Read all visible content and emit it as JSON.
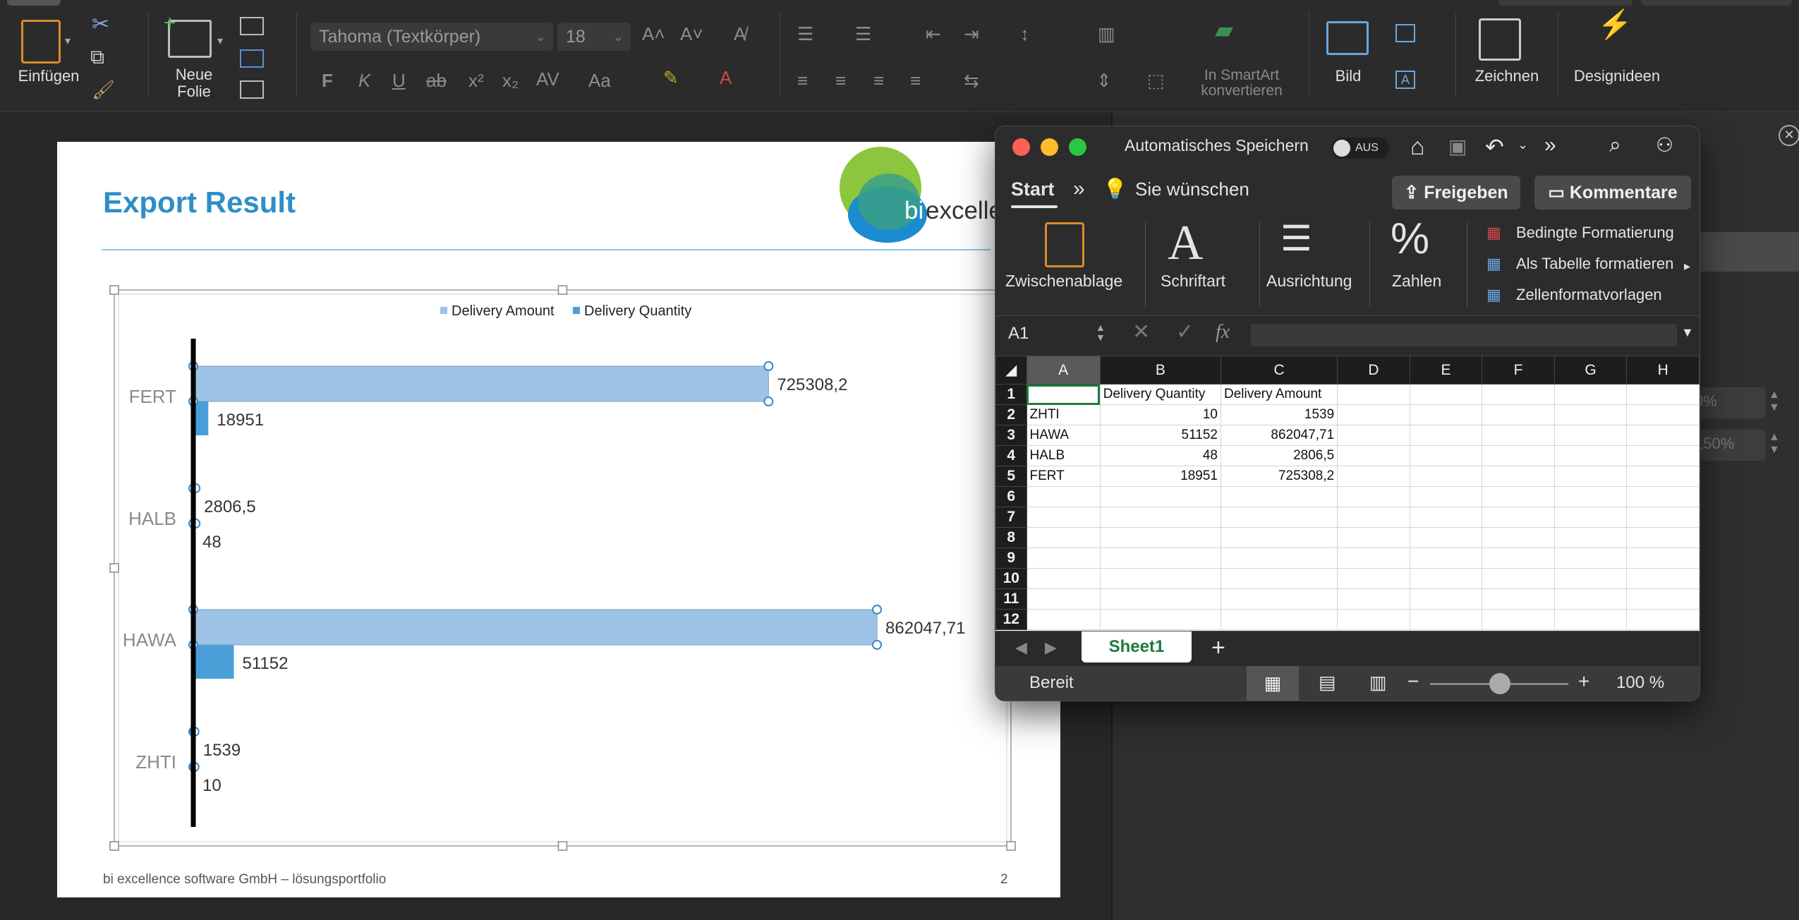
{
  "ppt_ribbon": {
    "paste_label": "Einfügen",
    "new_slide_label": "Neue Folie",
    "font_name": "Tahoma (Textkörper)",
    "font_size": "18",
    "smartart_label": "In SmartArt konvertieren",
    "picture_label": "Bild",
    "draw_label": "Zeichnen",
    "design_label": "Designideen"
  },
  "slide": {
    "title": "Export Result",
    "logo_text": "bi excelle",
    "footer": "bi excellence software GmbH – lösungsportfolio",
    "page_number": "2"
  },
  "chart_data": {
    "type": "bar",
    "orientation": "horizontal",
    "categories": [
      "FERT",
      "HALB",
      "HAWA",
      "ZHTI"
    ],
    "series": [
      {
        "name": "Delivery Amount",
        "values": [
          725308.2,
          2806.5,
          862047.71,
          1539
        ],
        "labels": [
          "725308,2",
          "2806,5",
          "862047,71",
          "1539"
        ],
        "color": "#9dc3e6"
      },
      {
        "name": "Delivery Quantity",
        "values": [
          18951,
          48,
          51152,
          10
        ],
        "labels": [
          "18951",
          "48",
          "51152",
          "10"
        ],
        "color": "#4a9fd8"
      }
    ],
    "legend": "top-center",
    "grid": false,
    "xlim": [
      0,
      870000
    ]
  },
  "right_panel": {
    "value1": "0%",
    "value2": "150%"
  },
  "excel": {
    "autosave_label": "Automatisches Speichern",
    "autosave_state": "AUS",
    "tab_start": "Start",
    "tell_me": "Sie wünschen",
    "share_label": "Freigeben",
    "comments_label": "Kommentare",
    "groups": {
      "clipboard": "Zwischenablage",
      "font": "Schriftart",
      "alignment": "Ausrichtung",
      "number": "Zahlen"
    },
    "styles": {
      "conditional": "Bedingte Formatierung",
      "as_table": "Als Tabelle formatieren",
      "cell_styles": "Zellenformatvorlagen"
    },
    "name_box": "A1",
    "fx": "fx",
    "columns": [
      "A",
      "B",
      "C",
      "D",
      "E",
      "F",
      "G",
      "H"
    ],
    "rows": [
      {
        "num": "1",
        "a": "",
        "b": "Delivery Quantity",
        "c": "Delivery Amount"
      },
      {
        "num": "2",
        "a": "ZHTI",
        "b": "10",
        "c": "1539"
      },
      {
        "num": "3",
        "a": "HAWA",
        "b": "51152",
        "c": "862047,71"
      },
      {
        "num": "4",
        "a": "HALB",
        "b": "48",
        "c": "2806,5"
      },
      {
        "num": "5",
        "a": "FERT",
        "b": "18951",
        "c": "725308,2"
      },
      {
        "num": "6",
        "a": "",
        "b": "",
        "c": ""
      },
      {
        "num": "7",
        "a": "",
        "b": "",
        "c": ""
      },
      {
        "num": "8",
        "a": "",
        "b": "",
        "c": ""
      },
      {
        "num": "9",
        "a": "",
        "b": "",
        "c": ""
      },
      {
        "num": "10",
        "a": "",
        "b": "",
        "c": ""
      },
      {
        "num": "11",
        "a": "",
        "b": "",
        "c": ""
      },
      {
        "num": "12",
        "a": "",
        "b": "",
        "c": ""
      }
    ],
    "sheet_tab": "Sheet1",
    "add_sheet": "+",
    "status": "Bereit",
    "zoom": "100 %"
  }
}
